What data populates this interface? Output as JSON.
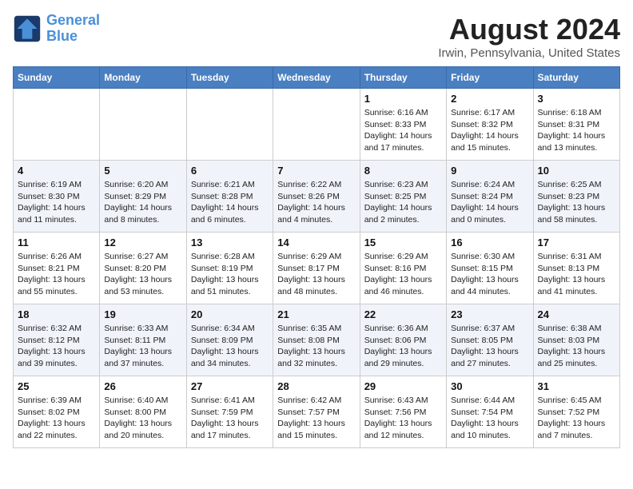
{
  "header": {
    "logo_text_general": "General",
    "logo_text_blue": "Blue",
    "month": "August 2024",
    "location": "Irwin, Pennsylvania, United States"
  },
  "weekdays": [
    "Sunday",
    "Monday",
    "Tuesday",
    "Wednesday",
    "Thursday",
    "Friday",
    "Saturday"
  ],
  "weeks": [
    [
      {
        "day": "",
        "info": ""
      },
      {
        "day": "",
        "info": ""
      },
      {
        "day": "",
        "info": ""
      },
      {
        "day": "",
        "info": ""
      },
      {
        "day": "1",
        "info": "Sunrise: 6:16 AM\nSunset: 8:33 PM\nDaylight: 14 hours\nand 17 minutes."
      },
      {
        "day": "2",
        "info": "Sunrise: 6:17 AM\nSunset: 8:32 PM\nDaylight: 14 hours\nand 15 minutes."
      },
      {
        "day": "3",
        "info": "Sunrise: 6:18 AM\nSunset: 8:31 PM\nDaylight: 14 hours\nand 13 minutes."
      }
    ],
    [
      {
        "day": "4",
        "info": "Sunrise: 6:19 AM\nSunset: 8:30 PM\nDaylight: 14 hours\nand 11 minutes."
      },
      {
        "day": "5",
        "info": "Sunrise: 6:20 AM\nSunset: 8:29 PM\nDaylight: 14 hours\nand 8 minutes."
      },
      {
        "day": "6",
        "info": "Sunrise: 6:21 AM\nSunset: 8:28 PM\nDaylight: 14 hours\nand 6 minutes."
      },
      {
        "day": "7",
        "info": "Sunrise: 6:22 AM\nSunset: 8:26 PM\nDaylight: 14 hours\nand 4 minutes."
      },
      {
        "day": "8",
        "info": "Sunrise: 6:23 AM\nSunset: 8:25 PM\nDaylight: 14 hours\nand 2 minutes."
      },
      {
        "day": "9",
        "info": "Sunrise: 6:24 AM\nSunset: 8:24 PM\nDaylight: 14 hours\nand 0 minutes."
      },
      {
        "day": "10",
        "info": "Sunrise: 6:25 AM\nSunset: 8:23 PM\nDaylight: 13 hours\nand 58 minutes."
      }
    ],
    [
      {
        "day": "11",
        "info": "Sunrise: 6:26 AM\nSunset: 8:21 PM\nDaylight: 13 hours\nand 55 minutes."
      },
      {
        "day": "12",
        "info": "Sunrise: 6:27 AM\nSunset: 8:20 PM\nDaylight: 13 hours\nand 53 minutes."
      },
      {
        "day": "13",
        "info": "Sunrise: 6:28 AM\nSunset: 8:19 PM\nDaylight: 13 hours\nand 51 minutes."
      },
      {
        "day": "14",
        "info": "Sunrise: 6:29 AM\nSunset: 8:17 PM\nDaylight: 13 hours\nand 48 minutes."
      },
      {
        "day": "15",
        "info": "Sunrise: 6:29 AM\nSunset: 8:16 PM\nDaylight: 13 hours\nand 46 minutes."
      },
      {
        "day": "16",
        "info": "Sunrise: 6:30 AM\nSunset: 8:15 PM\nDaylight: 13 hours\nand 44 minutes."
      },
      {
        "day": "17",
        "info": "Sunrise: 6:31 AM\nSunset: 8:13 PM\nDaylight: 13 hours\nand 41 minutes."
      }
    ],
    [
      {
        "day": "18",
        "info": "Sunrise: 6:32 AM\nSunset: 8:12 PM\nDaylight: 13 hours\nand 39 minutes."
      },
      {
        "day": "19",
        "info": "Sunrise: 6:33 AM\nSunset: 8:11 PM\nDaylight: 13 hours\nand 37 minutes."
      },
      {
        "day": "20",
        "info": "Sunrise: 6:34 AM\nSunset: 8:09 PM\nDaylight: 13 hours\nand 34 minutes."
      },
      {
        "day": "21",
        "info": "Sunrise: 6:35 AM\nSunset: 8:08 PM\nDaylight: 13 hours\nand 32 minutes."
      },
      {
        "day": "22",
        "info": "Sunrise: 6:36 AM\nSunset: 8:06 PM\nDaylight: 13 hours\nand 29 minutes."
      },
      {
        "day": "23",
        "info": "Sunrise: 6:37 AM\nSunset: 8:05 PM\nDaylight: 13 hours\nand 27 minutes."
      },
      {
        "day": "24",
        "info": "Sunrise: 6:38 AM\nSunset: 8:03 PM\nDaylight: 13 hours\nand 25 minutes."
      }
    ],
    [
      {
        "day": "25",
        "info": "Sunrise: 6:39 AM\nSunset: 8:02 PM\nDaylight: 13 hours\nand 22 minutes."
      },
      {
        "day": "26",
        "info": "Sunrise: 6:40 AM\nSunset: 8:00 PM\nDaylight: 13 hours\nand 20 minutes."
      },
      {
        "day": "27",
        "info": "Sunrise: 6:41 AM\nSunset: 7:59 PM\nDaylight: 13 hours\nand 17 minutes."
      },
      {
        "day": "28",
        "info": "Sunrise: 6:42 AM\nSunset: 7:57 PM\nDaylight: 13 hours\nand 15 minutes."
      },
      {
        "day": "29",
        "info": "Sunrise: 6:43 AM\nSunset: 7:56 PM\nDaylight: 13 hours\nand 12 minutes."
      },
      {
        "day": "30",
        "info": "Sunrise: 6:44 AM\nSunset: 7:54 PM\nDaylight: 13 hours\nand 10 minutes."
      },
      {
        "day": "31",
        "info": "Sunrise: 6:45 AM\nSunset: 7:52 PM\nDaylight: 13 hours\nand 7 minutes."
      }
    ]
  ]
}
